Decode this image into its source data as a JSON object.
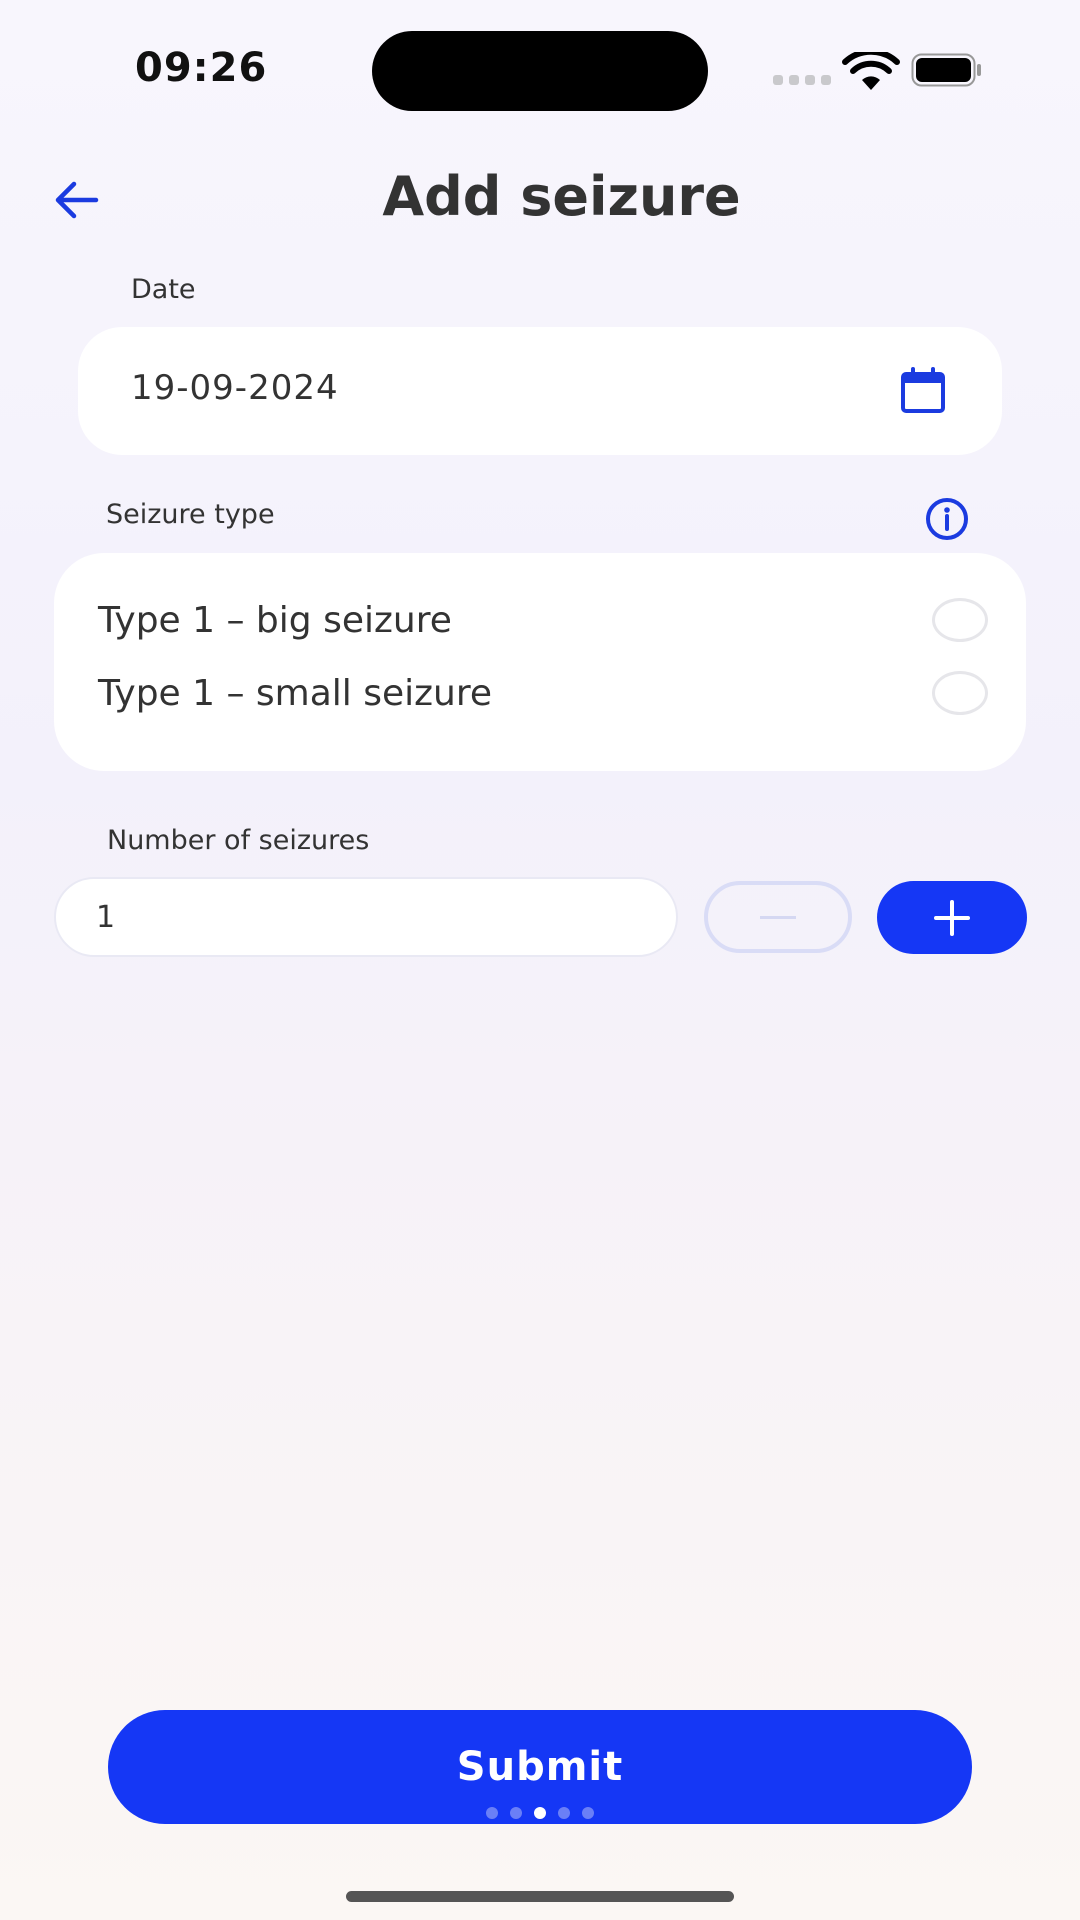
{
  "status_bar": {
    "time": "09:26"
  },
  "header": {
    "title": "Add seizure",
    "back_icon": "arrow-left-icon"
  },
  "date": {
    "label": "Date",
    "value": "19-09-2024",
    "icon": "calendar-icon"
  },
  "seizure_type": {
    "label": "Seizure type",
    "info_icon": "info-icon",
    "options": [
      {
        "label": "Type 1 – big seizure",
        "selected": false
      },
      {
        "label": "Type 1 – small seizure",
        "selected": false
      }
    ]
  },
  "number_of_seizures": {
    "label": "Number of seizures",
    "value": "1"
  },
  "submit": {
    "label": "Submit"
  },
  "pager": {
    "count": 5,
    "active_index": 2
  },
  "colors": {
    "accent": "#1537f5",
    "text": "#333333",
    "card": "#ffffff"
  }
}
